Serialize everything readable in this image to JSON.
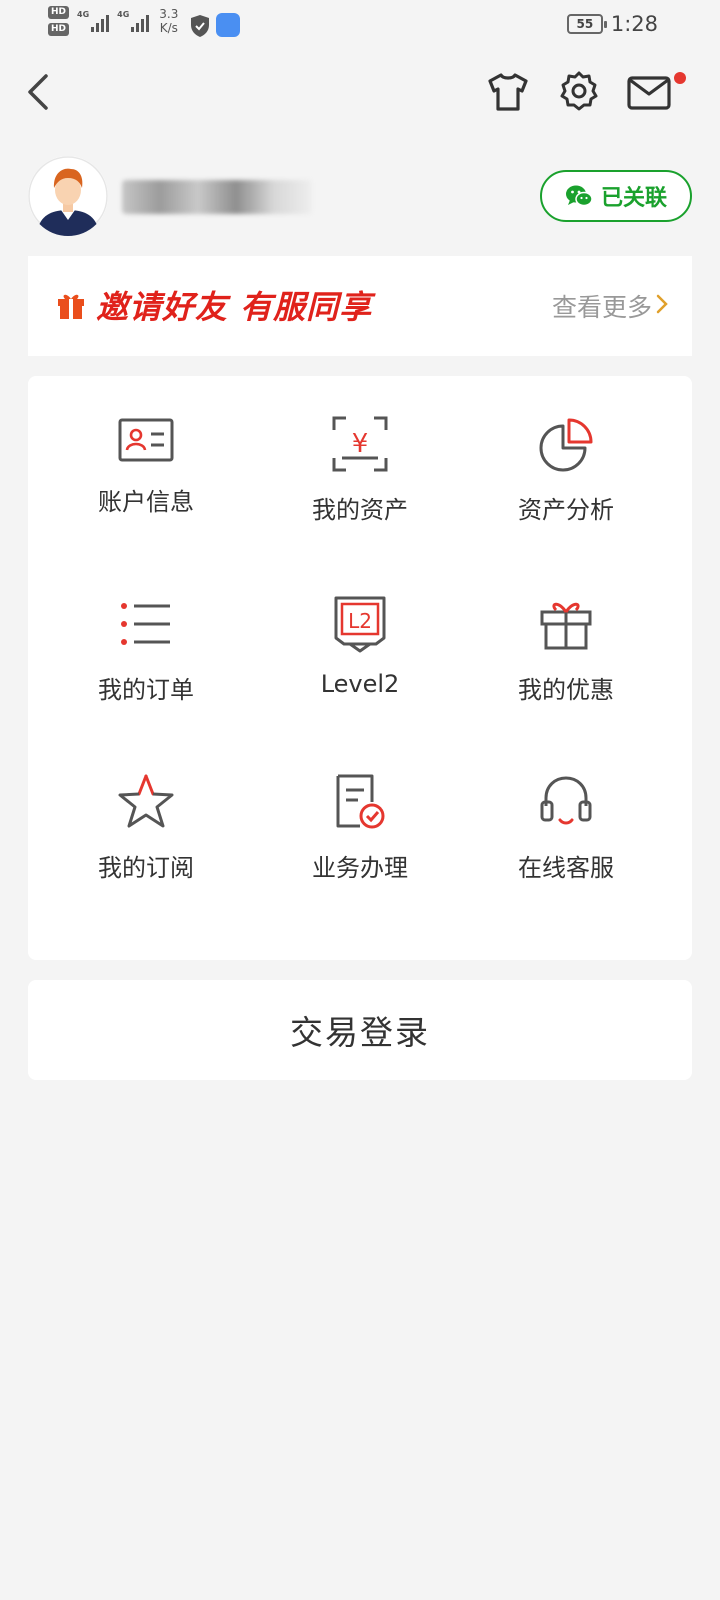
{
  "status_bar": {
    "hd1": "HD",
    "hd2": "HD",
    "net1": "4G",
    "net2": "4G",
    "speed_value": "3.3",
    "speed_unit": "K/s",
    "battery": "55",
    "time": "1:28"
  },
  "nav": {
    "icons": [
      "back-icon",
      "tshirt-icon",
      "gear-icon",
      "mail-icon"
    ]
  },
  "user": {
    "name": "▇ ▇▇ ▇▇",
    "wechat_status": "已关联"
  },
  "banner": {
    "title": "邀请好友 有服同享",
    "more": "查看更多"
  },
  "grid": {
    "items": [
      {
        "label": "账户信息",
        "icon": "id-card-icon"
      },
      {
        "label": "我的资产",
        "icon": "yuan-scan-icon"
      },
      {
        "label": "资产分析",
        "icon": "pie-chart-icon"
      },
      {
        "label": "我的订单",
        "icon": "list-icon"
      },
      {
        "label": "Level2",
        "icon": "level2-icon"
      },
      {
        "label": "我的优惠",
        "icon": "gift-icon"
      },
      {
        "label": "我的订阅",
        "icon": "star-icon"
      },
      {
        "label": "业务办理",
        "icon": "document-check-icon"
      },
      {
        "label": "在线客服",
        "icon": "headset-icon"
      }
    ]
  },
  "trade": {
    "label": "交易登录"
  },
  "colors": {
    "accent_red": "#e0221b",
    "wechat_green": "#1aa12d",
    "background": "#f4f4f4"
  }
}
